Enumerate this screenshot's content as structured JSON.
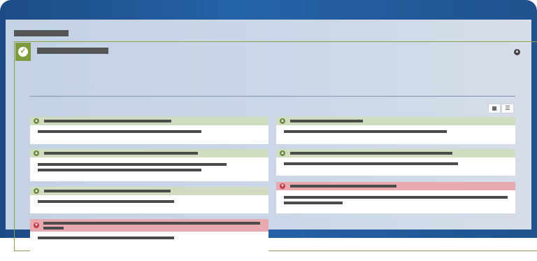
{
  "panel": {
    "status_icon": "check-icon",
    "collapse_icon": "chevron-up-icon"
  },
  "view_toggle": {
    "grid_icon": "grid-icon",
    "list_icon": "list-icon",
    "active": "list"
  },
  "cards": [
    {
      "status": "success",
      "status_icon": "chevron-up-icon"
    },
    {
      "status": "success",
      "status_icon": "chevron-up-icon"
    },
    {
      "status": "success",
      "status_icon": "chevron-up-icon"
    },
    {
      "status": "success",
      "status_icon": "chevron-up-icon"
    },
    {
      "status": "success",
      "status_icon": "chevron-up-icon"
    },
    {
      "status": "error",
      "status_icon": "chevron-down-icon"
    },
    {
      "status": "error",
      "status_icon": "chevron-down-icon"
    }
  ],
  "colors": {
    "frame": "#2563a8",
    "screen_bg": "#ccd8e8",
    "panel_accent": "#7f9a3c",
    "success_header": "#d0dcbf",
    "error_header": "#e7a9ad",
    "success_icon": "#6e8b3d",
    "error_icon": "#c93b46"
  }
}
